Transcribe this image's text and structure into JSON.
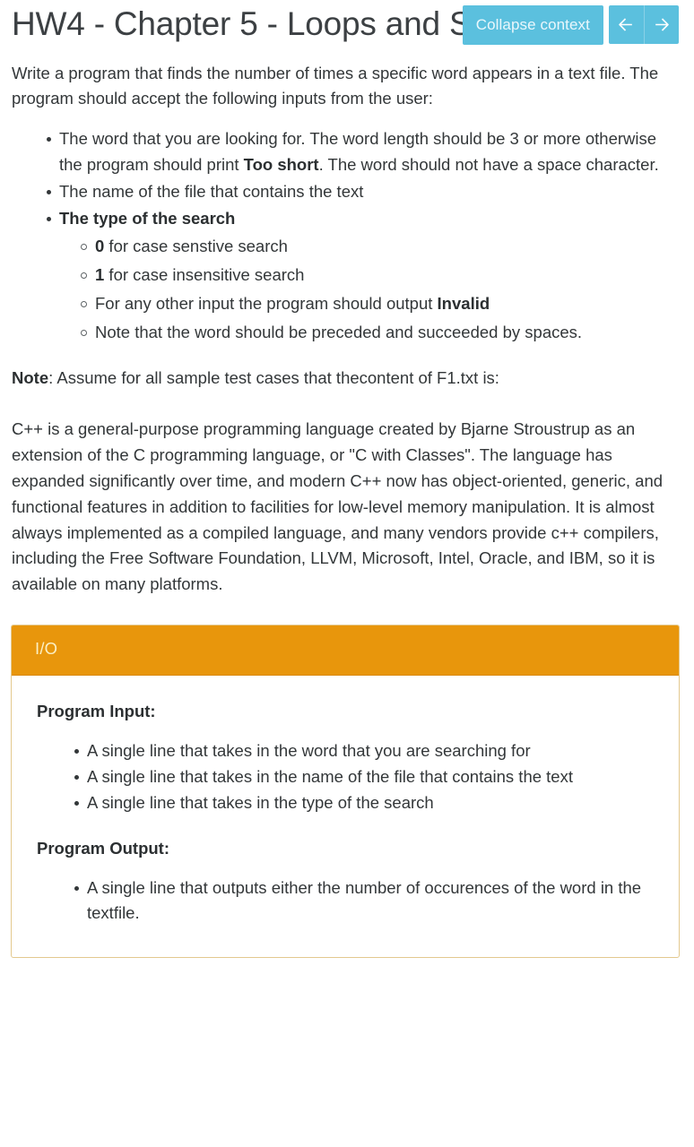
{
  "toolbar": {
    "collapse_label": "Collapse context",
    "prev_icon": "arrow-left-icon",
    "next_icon": "arrow-right-icon",
    "button_color": "#5bc0de",
    "button_text_color": "#eaf7fc"
  },
  "page": {
    "title": "HW4 - Chapter 5 - Loops and Strings",
    "intro": "Write a program that finds the number of times a specific word appears in a text file. The program should accept the following inputs from the user:",
    "requirements": [
      {
        "text_before": "The word that you are looking for. The word length should be 3 or more otherwise the program should print ",
        "bold": "Too short",
        "text_after": ". The word should not have a space character."
      },
      {
        "text_before": "The name of the file that contains the text",
        "bold": "",
        "text_after": ""
      }
    ],
    "search_type_label": "The type of the search",
    "search_type_items": [
      {
        "bold": "0",
        "text": " for case senstive search"
      },
      {
        "bold": "1",
        "text": " for case insensitive search"
      },
      {
        "bold": "",
        "text": "For any other input the program should output ",
        "bold_after": "Invalid"
      },
      {
        "bold": "",
        "text": "Note that the word should be preceded and succeeded by spaces."
      }
    ],
    "note_label": "Note",
    "note_text": ": Assume for all sample test cases that thecontent of F1.txt is:",
    "quote": "C++ is a general-purpose programming language created by Bjarne Stroustrup as an extension of the C programming language, or \"C with Classes\". The language has expanded significantly over time, and modern C++ now has object-oriented, generic, and functional features in addition to facilities for low-level memory manipulation. It is almost always implemented as a compiled language, and many vendors provide c++ compilers, including the Free Software Foundation, LLVM, Microsoft, Intel, Oracle, and IBM, so it is available on many platforms."
  },
  "io_panel": {
    "header_title": "I/O",
    "header_color": "#e8960c",
    "header_text_color": "#fbefc4",
    "border_color": "#e3c98f",
    "input_heading": "Program Input:",
    "input_items": [
      "A single line that takes in the word that you are searching for",
      "A single line that takes in the name of the file that contains the text",
      "A single line that takes in the type of the search"
    ],
    "output_heading": "Program Output:",
    "output_items": [
      "A single line that outputs either the number of occurences of the word in the textfile."
    ]
  }
}
